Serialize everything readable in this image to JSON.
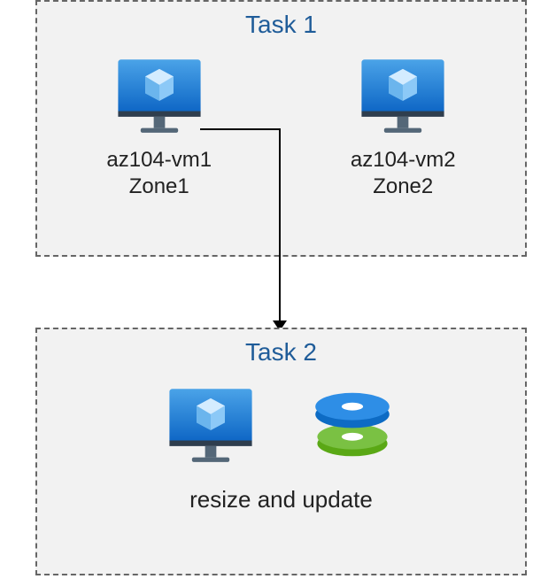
{
  "task1": {
    "title": "Task 1",
    "vm1": {
      "name": "az104-vm1",
      "zone": "Zone1"
    },
    "vm2": {
      "name": "az104-vm2",
      "zone": "Zone2"
    }
  },
  "task2": {
    "title": "Task 2",
    "action": "resize and update"
  }
}
